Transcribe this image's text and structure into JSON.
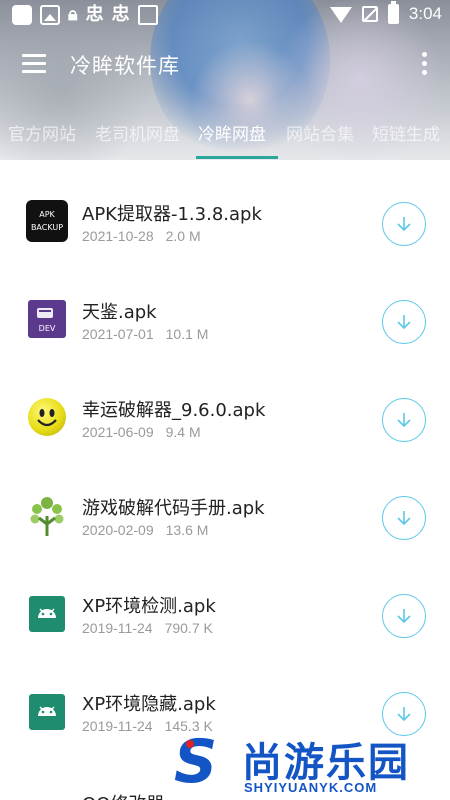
{
  "status_bar": {
    "time": "3:04",
    "left_glyphs": [
      "忠",
      "忠"
    ]
  },
  "toolbar": {
    "title": "冷眸软件库"
  },
  "tabs": [
    {
      "label": "官方网站",
      "active": false
    },
    {
      "label": "老司机网盘",
      "active": false
    },
    {
      "label": "冷眸网盘",
      "active": true
    },
    {
      "label": "网站合集",
      "active": false
    },
    {
      "label": "短链生成",
      "active": false
    }
  ],
  "files": [
    {
      "name": "APK提取器-1.3.8.apk",
      "date": "2021-10-28",
      "size": "2.0 M",
      "icon": "apk-backup-icon",
      "icon_text": [
        "APK",
        "BACKUP"
      ]
    },
    {
      "name": "天鉴.apk",
      "date": "2021-07-01",
      "size": "10.1 M",
      "icon": "dev-icon",
      "icon_text": [
        "DEV"
      ]
    },
    {
      "name": "幸运破解器_9.6.0.apk",
      "date": "2021-06-09",
      "size": "9.4 M",
      "icon": "smiley-icon"
    },
    {
      "name": "游戏破解代码手册.apk",
      "date": "2020-02-09",
      "size": "13.6 M",
      "icon": "tree-icon"
    },
    {
      "name": "XP环境检测.apk",
      "date": "2019-11-24",
      "size": "790.7 K",
      "icon": "android-icon"
    },
    {
      "name": "XP环境隐藏.apk",
      "date": "2019-11-24",
      "size": "145.3 K",
      "icon": "android-icon"
    }
  ],
  "partial_item": "QQ修改器",
  "watermark": {
    "letter": "S",
    "text": "尚游乐园",
    "url": "SHYIYUANYK.COM"
  },
  "colors": {
    "accent": "#2aa79b",
    "download_ring": "#5cc8e6",
    "watermark": "#1455c5"
  }
}
